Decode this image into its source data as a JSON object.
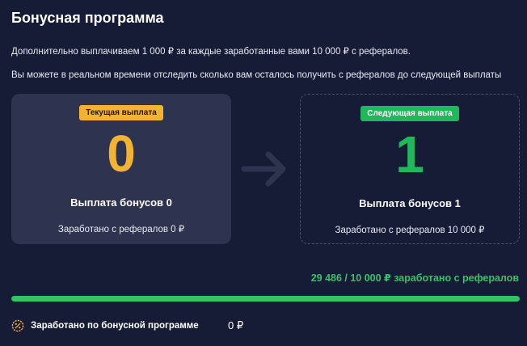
{
  "header": {
    "title": "Бонусная программа",
    "description_line1": "Дополнительно выплачиваем 1 000 ₽ за каждые заработанные вами 10 000 ₽ с рефералов.",
    "description_line2": "Вы можете в реальном времени отследить сколько вам осталось получить с рефералов до следующей выплаты"
  },
  "current_card": {
    "badge": "Текущая выплата",
    "number": "0",
    "title": "Выплата бонусов 0",
    "subtitle": "Заработано с рефералов 0 ₽",
    "accent_color": "#f2b232"
  },
  "next_card": {
    "badge": "Следующая выплата",
    "number": "1",
    "title": "Выплата бонусов 1",
    "subtitle": "Заработано с рефералов 10 000 ₽",
    "accent_color": "#1fb85c"
  },
  "arrow_icon": "arrow-right-icon",
  "progress": {
    "text": "29 486 / 10 000 ₽ заработано с рефералов",
    "fraction": 1.0,
    "color": "#33c26b"
  },
  "footer": {
    "icon": "percent-badge-icon",
    "label": "Заработано по бонусной программе",
    "value": "0 ₽"
  },
  "colors": {
    "background": "#171c36",
    "card": "#2e3350"
  }
}
